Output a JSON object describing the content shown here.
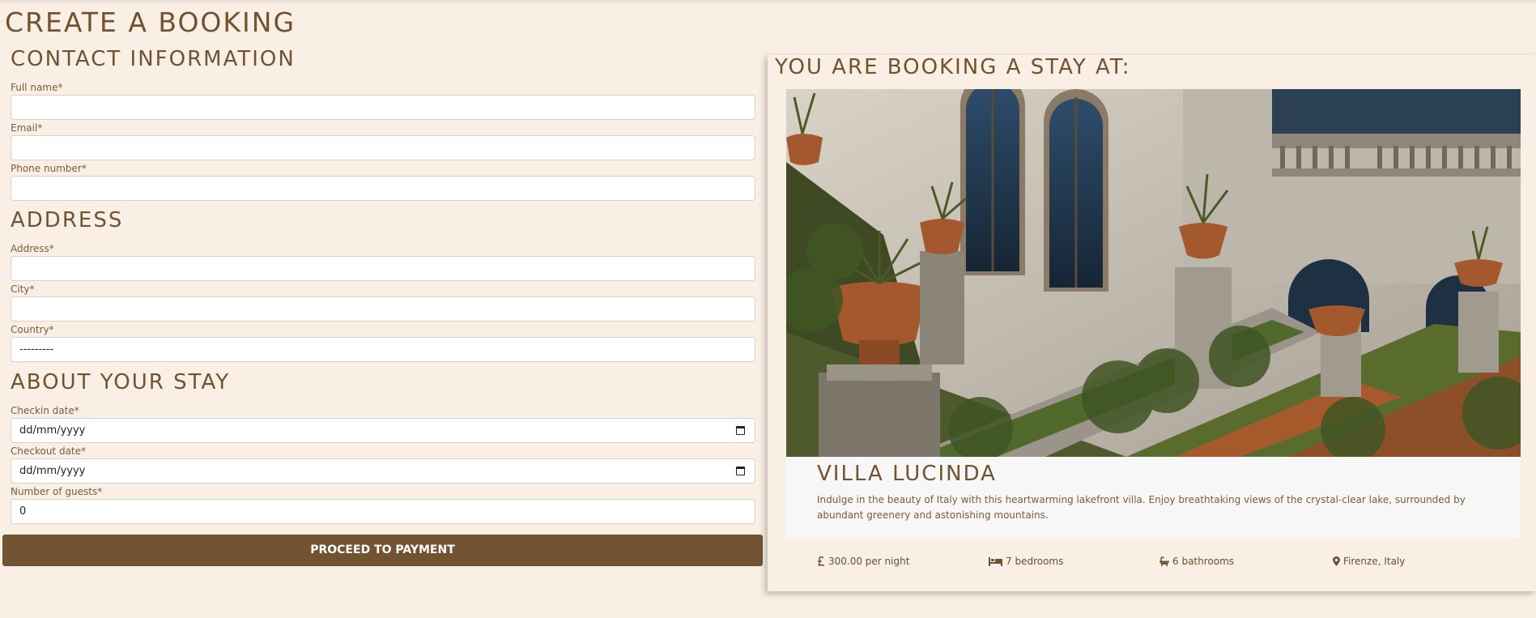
{
  "page": {
    "title": "CREATE A BOOKING"
  },
  "sections": {
    "contact": "CONTACT INFORMATION",
    "address": "ADDRESS",
    "stay": "ABOUT YOUR STAY"
  },
  "fields": {
    "full_name": {
      "label": "Full name*",
      "value": ""
    },
    "email": {
      "label": "Email*",
      "value": ""
    },
    "phone": {
      "label": "Phone number*",
      "value": ""
    },
    "address": {
      "label": "Address*",
      "value": ""
    },
    "city": {
      "label": "City*",
      "value": ""
    },
    "country": {
      "label": "Country*",
      "value": "---------"
    },
    "checkin": {
      "label": "Checkin date*",
      "value": "dd/mm/yyyy"
    },
    "checkout": {
      "label": "Checkout date*",
      "value": "dd/mm/yyyy"
    },
    "guests": {
      "label": "Number of guests*",
      "value": "0"
    }
  },
  "submit_label": "PROCEED TO PAYMENT",
  "card": {
    "title": "YOU ARE BOOKING A STAY AT:",
    "villa_name": "VILLA LUCINDA",
    "description": "Indulge in the beauty of Italy with this heartwarming lakefront villa. Enjoy breathtaking views of the crystal-clear lake, surrounded by abundant greenery and astonishing mountains.",
    "price": "300.00 per night",
    "bedrooms": "7 bedrooms",
    "bathrooms": "6 bathrooms",
    "location": "Firenze, Italy"
  },
  "icons": {
    "price": "pound-icon",
    "bedrooms": "bed-icon",
    "bathrooms": "bath-icon",
    "location": "map-pin-icon",
    "date": "calendar-icon"
  },
  "colors": {
    "background": "#f9efe4",
    "accent": "#725331",
    "input_bg": "#ffffff",
    "info_box": "#f7f7f8"
  }
}
